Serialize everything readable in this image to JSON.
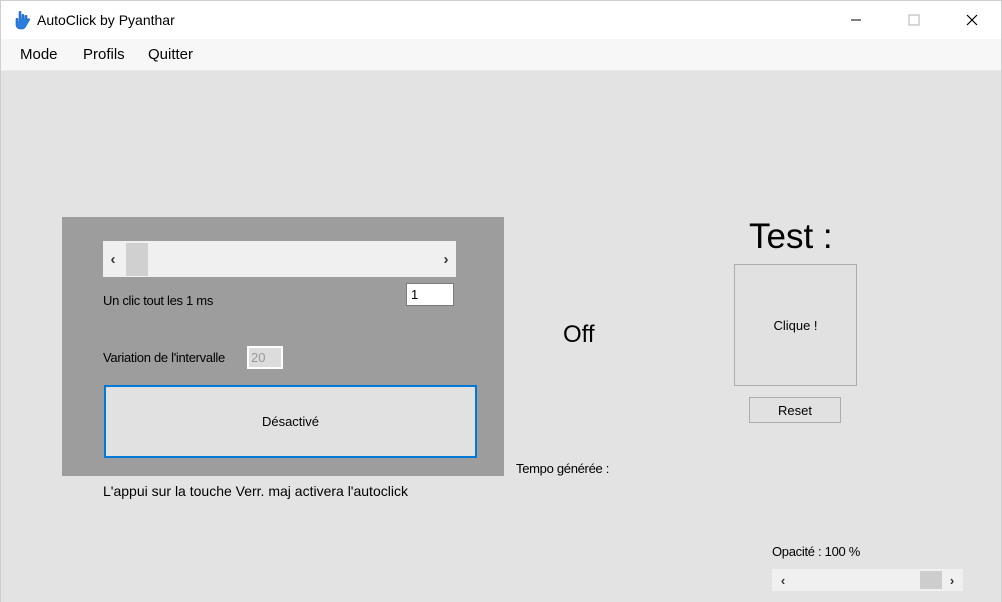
{
  "window": {
    "title": "AutoClick by Pyanthar",
    "controls": {
      "minimize": "—",
      "maximize": "☐",
      "close": "✕"
    }
  },
  "menu": {
    "items": [
      "Mode",
      "Profils",
      "Quitter"
    ]
  },
  "panel": {
    "scroll_left": "‹",
    "scroll_right": "›",
    "interval_label": "Un clic tout les 1 ms",
    "interval_value": "1",
    "variation_label": "Variation de l'intervalle",
    "variation_value": "20",
    "toggle_label": "Désactivé"
  },
  "hint": "L'appui sur la touche Verr. maj activera l'autoclick",
  "status": "Off",
  "tempo_label": "Tempo générée :",
  "test": {
    "title": "Test :",
    "click_button": "Clique !",
    "reset_button": "Reset"
  },
  "opacity": {
    "label": "Opacité : 100 %",
    "value_percent": 100,
    "scroll_left": "‹",
    "scroll_right": "›"
  },
  "colors": {
    "panel_bg": "#9d9d9d",
    "accent": "#0078d7",
    "window_bg": "#e3e3e3"
  }
}
